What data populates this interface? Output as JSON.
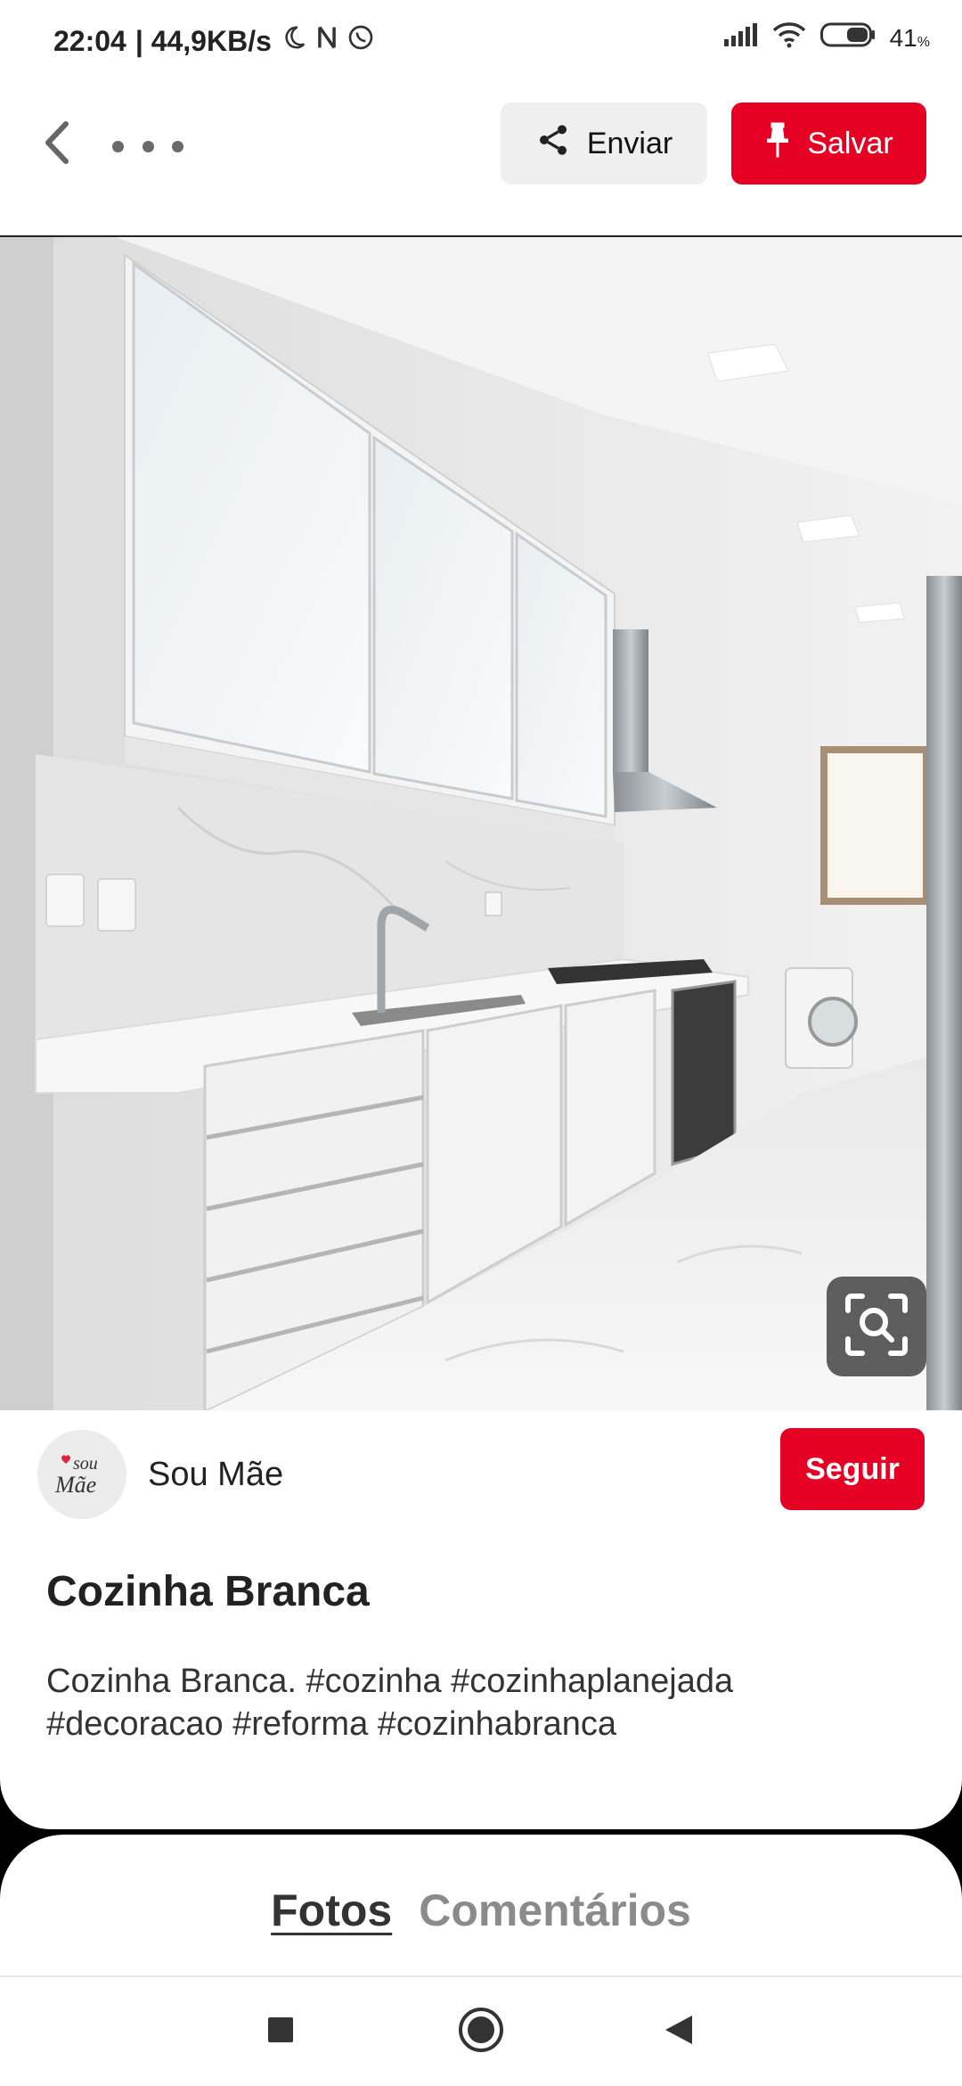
{
  "status_bar": {
    "time": "22:04",
    "net_speed": "| 44,9KB/s",
    "battery": "41",
    "battery_unit": "%"
  },
  "toolbar": {
    "send_label": "Enviar",
    "save_label": "Salvar"
  },
  "pin": {
    "creator": {
      "name": "Sou Mãe",
      "avatar_text_top": "sou",
      "avatar_text_bottom": "Mãe"
    },
    "follow_label": "Seguir",
    "title": "Cozinha Branca",
    "description": "Cozinha Branca. #cozinha #cozinhaplanejada #decoracao #reforma #cozinhabranca"
  },
  "tabs": [
    {
      "label": "Fotos",
      "active": true
    },
    {
      "label": "Comentários",
      "active": false
    }
  ],
  "icons": {
    "back": "chevron-left-icon",
    "more": "more-horizontal-icon",
    "share": "share-icon",
    "pin": "pin-icon",
    "lens": "visual-search-icon",
    "nav_recent": "square-icon",
    "nav_home": "circle-icon",
    "nav_back": "triangle-back-icon"
  },
  "colors": {
    "brand_red": "#e60023",
    "send_bg": "#efefef"
  }
}
